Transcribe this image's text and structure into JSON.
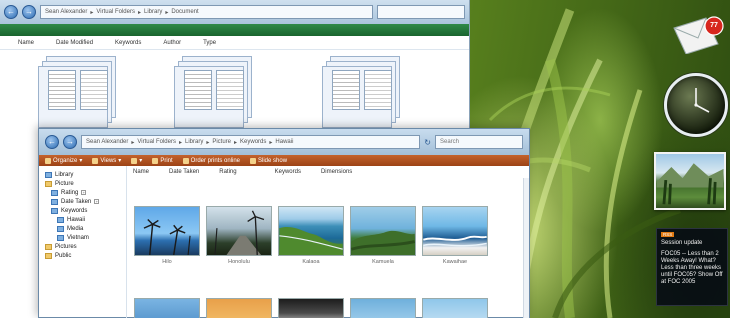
{
  "back_window": {
    "address": {
      "crumbs": [
        "Sean Alexander",
        "Virtual Folders",
        "Library",
        "Document"
      ]
    },
    "columns": [
      "Name",
      "Date Modified",
      "Keywords",
      "Author",
      "Type"
    ]
  },
  "front_window": {
    "address": {
      "crumbs": [
        "Sean Alexander",
        "Virtual Folders",
        "Library",
        "Picture",
        "Keywords",
        "Hawaii"
      ]
    },
    "search_placeholder": "Search",
    "toolbar": [
      {
        "label": "Organize",
        "icon": "organize-icon"
      },
      {
        "label": "Views",
        "icon": "views-icon"
      },
      {
        "label": "Print",
        "icon": "print-icon"
      },
      {
        "label": "Order prints online",
        "icon": "order-prints-icon"
      },
      {
        "label": "Slide show",
        "icon": "slideshow-icon"
      }
    ],
    "tree": [
      {
        "label": "Library",
        "level": 1,
        "icon": "library-icon"
      },
      {
        "label": "Picture",
        "level": 1,
        "icon": "folder-icon"
      },
      {
        "label": "Rating",
        "level": 2,
        "icon": "folder-icon"
      },
      {
        "label": "Date Taken",
        "level": 2,
        "icon": "folder-icon"
      },
      {
        "label": "Keywords",
        "level": 2,
        "icon": "folder-icon"
      },
      {
        "label": "Hawaii",
        "level": 3,
        "icon": "folder-icon"
      },
      {
        "label": "Media",
        "level": 3,
        "icon": "folder-icon"
      },
      {
        "label": "Vietnam",
        "level": 3,
        "icon": "folder-icon"
      },
      {
        "label": "Pictures",
        "level": 1,
        "icon": "folder-icon"
      },
      {
        "label": "Public",
        "level": 1,
        "icon": "folder-icon"
      }
    ],
    "columns": [
      "Name",
      "Date Taken",
      "Rating",
      "Keywords",
      "Dimensions"
    ],
    "photos": [
      {
        "label": "Hilo"
      },
      {
        "label": "Honolulu"
      },
      {
        "label": "Kalaoa"
      },
      {
        "label": "Kamuela"
      },
      {
        "label": "Kawaihae"
      }
    ]
  },
  "gadgets": {
    "mail": {
      "count": "77"
    },
    "feed": {
      "tag": "RSS",
      "title": "Session update",
      "body": "FOC05 -- Less than 2 Weeks Away! What? Less than three weeks until FOC05? Show Off at FOC 2005"
    }
  },
  "colors": {
    "back_toolbar": "#19642e",
    "front_toolbar": "#b15420",
    "wallpaper": "#6f9b2a",
    "feed_accent": "#e07a12"
  }
}
